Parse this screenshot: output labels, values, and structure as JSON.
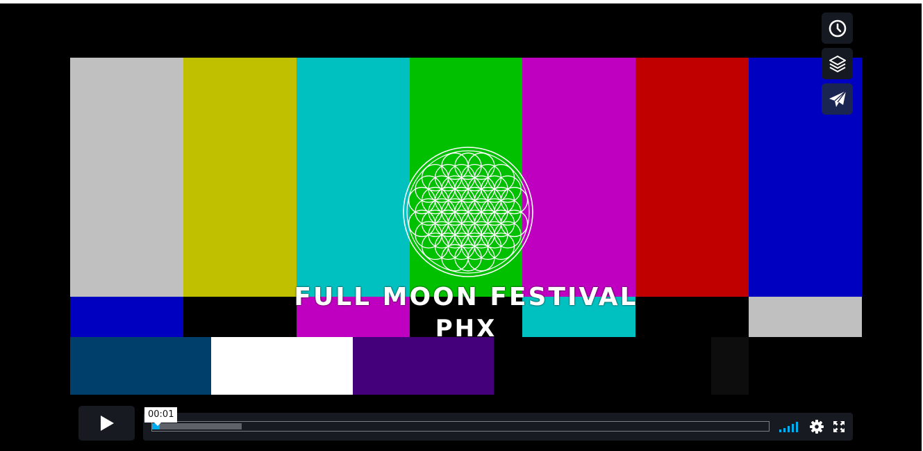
{
  "video": {
    "title_line1": "FULL MOON FESTIVAL",
    "title_line2": "PHX",
    "color_bars_top": [
      "#c0c0c0",
      "#c0c000",
      "#00c0c0",
      "#00c000",
      "#c000c0",
      "#c00000",
      "#0000c0"
    ],
    "color_bars_mid": [
      "#0000c0",
      "#000000",
      "#c000c0",
      "#000000",
      "#00c0c0",
      "#000000",
      "#c0c0c0"
    ],
    "color_bars_bottom": [
      "#003f6b",
      "#ffffff",
      "#43007a",
      "#000000",
      "#0d0d0d",
      "#000000"
    ]
  },
  "side_buttons": [
    {
      "name": "watch-later",
      "icon": "clock-icon"
    },
    {
      "name": "collections",
      "icon": "layers-icon"
    },
    {
      "name": "share",
      "icon": "paper-plane-icon"
    }
  ],
  "controls": {
    "play_icon": "play-icon",
    "current_time": "00:01",
    "progress_played": 0.01,
    "progress_buffered": 0.145,
    "volume_icon": "volume-bars-icon",
    "settings_icon": "gear-icon",
    "fullscreen_icon": "fullscreen-icon",
    "accent_color": "#00adef"
  }
}
